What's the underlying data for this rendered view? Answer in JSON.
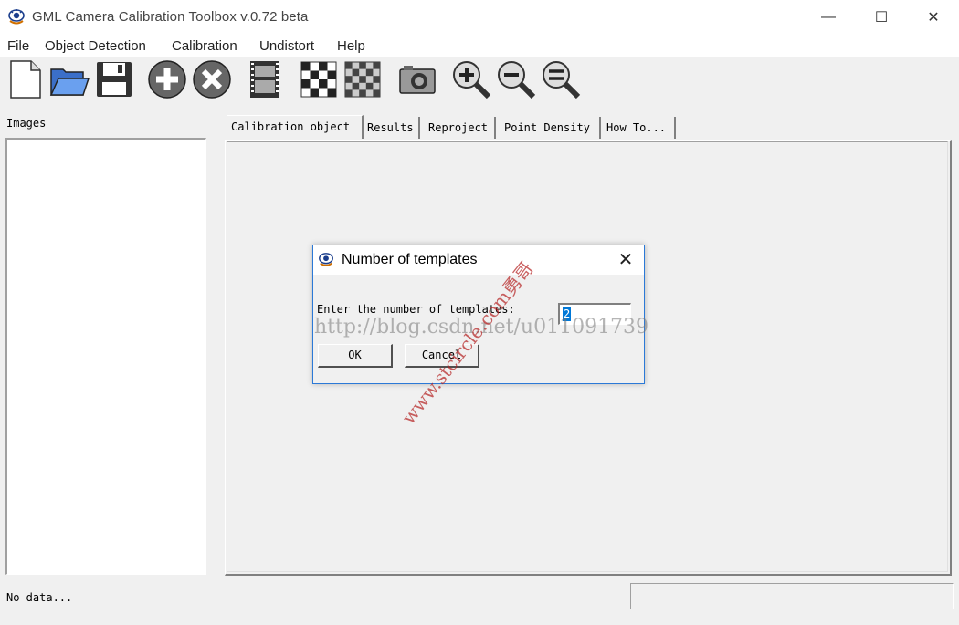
{
  "window": {
    "title": "GML Camera Calibration Toolbox  v.0.72 beta",
    "minimize_glyph": "—",
    "maximize_glyph": "☐",
    "close_glyph": "✕"
  },
  "menu": [
    "File",
    "Object Detection",
    "Calibration",
    "Undistort",
    "Help"
  ],
  "toolbar": {
    "buttons": [
      "new-file-icon",
      "open-folder-icon",
      "save-icon",
      "add-icon",
      "remove-icon",
      "film-strip-icon",
      "checkerboard-icon",
      "checkerboard-alt-icon",
      "camera-icon",
      "zoom-in-icon",
      "zoom-out-icon",
      "zoom-reset-icon"
    ]
  },
  "left_panel": {
    "label": "Images"
  },
  "tabs": [
    "Calibration object",
    "Results",
    "Reproject",
    "Point Density",
    "How To..."
  ],
  "status": {
    "text": "No data..."
  },
  "dialog": {
    "title": "Number of templates",
    "close_glyph": "✕",
    "prompt": "Enter the number of templates:",
    "value": "2",
    "ok_label": "OK",
    "cancel_label": "Cancel"
  },
  "watermark": {
    "url": "http://blog.csdn.net/u011091739",
    "diagonal": "www.stcircle.com勇哥"
  },
  "colors": {
    "accent": "#0078d7",
    "dialog_border": "#2b79d7"
  }
}
